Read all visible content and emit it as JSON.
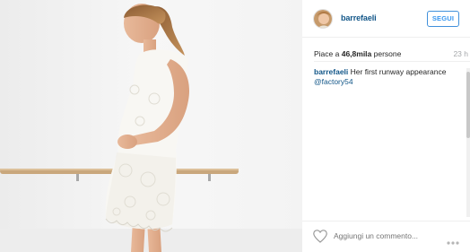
{
  "post": {
    "username": "barrefaeli",
    "follow_label": "SEGUI",
    "likes_prefix": "Piace a ",
    "likes_count": "46,8mila",
    "likes_suffix": " persone",
    "time": "23 h",
    "caption": {
      "user": "barrefaeli",
      "text": " Her first runway appearance ",
      "tag": "@factory54"
    },
    "comment_placeholder": "Aggiungi un commento...",
    "more_label": "•••"
  },
  "icons": {
    "heart": "heart-outline-icon",
    "more": "more-options-icon"
  },
  "colors": {
    "link": "#125688",
    "follow": "#3897f0",
    "muted": "#a5a7aa"
  }
}
